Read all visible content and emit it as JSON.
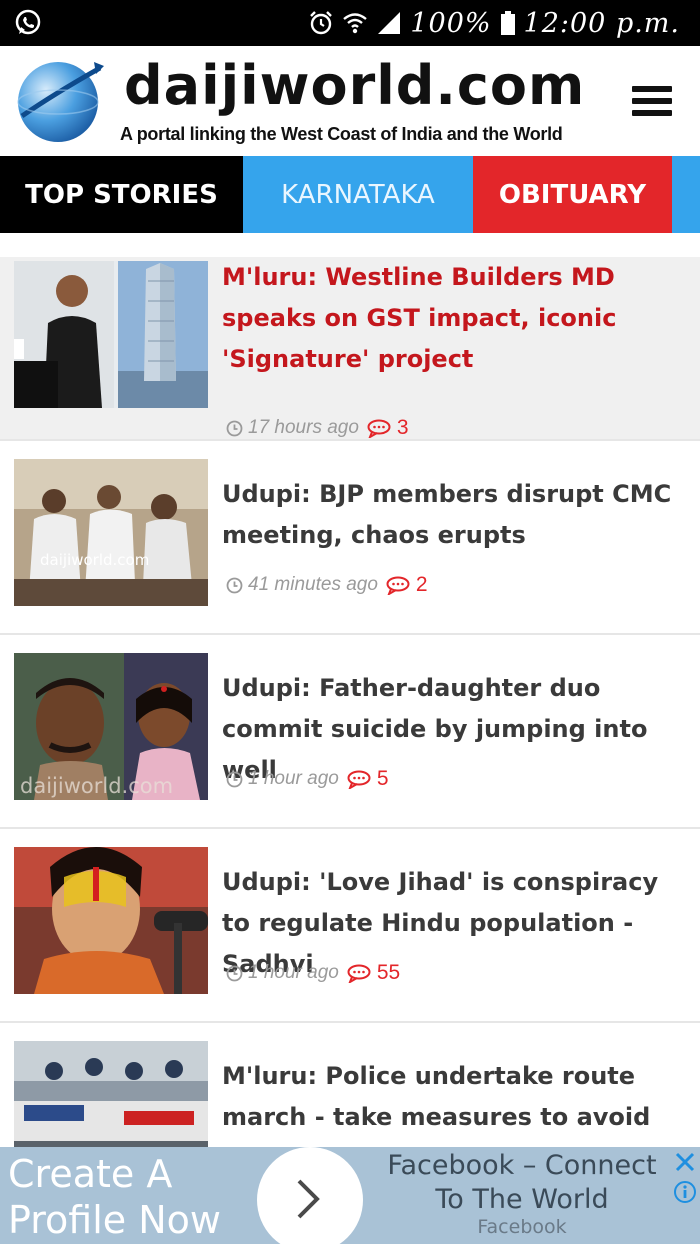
{
  "status_bar": {
    "battery": "100%",
    "time": "12:00 p.m."
  },
  "header": {
    "site_name": "daijiworld.com",
    "tagline": "A portal linking the West Coast of India and the World"
  },
  "tabs": [
    {
      "label": "TOP STORIES"
    },
    {
      "label": "KARNATAKA"
    },
    {
      "label": "OBITUARY"
    },
    {
      "label": ""
    }
  ],
  "articles": [
    {
      "title": "M'luru: Westline Builders MD speaks on GST impact, iconic 'Signature' project",
      "time": "17 hours ago",
      "comments": "3"
    },
    {
      "title": "Udupi: BJP members disrupt CMC meeting, chaos erupts",
      "time": "41 minutes ago",
      "comments": "2",
      "watermark": "daijiworld.com"
    },
    {
      "title": "Udupi: Father-daughter duo commit suicide by jumping into well",
      "time": "1 hour ago",
      "comments": "5",
      "watermark": "daijiworld.com"
    },
    {
      "title": "Udupi: 'Love Jihad' is conspiracy to regulate Hindu population - Sadhvi",
      "time": "1 hour ago",
      "comments": "55"
    },
    {
      "title": "M'luru: Police undertake route march - take measures to avoid tensions",
      "time": "",
      "comments": ""
    }
  ],
  "ad": {
    "text_line1": "Create A",
    "text_line2": "Profile Now",
    "headline_line1": "Facebook – Connect",
    "headline_line2": "To The World",
    "source": "Facebook"
  },
  "colors": {
    "accent_red": "#e3262a",
    "accent_blue": "#35a4ec",
    "title_red": "#c4171d"
  }
}
